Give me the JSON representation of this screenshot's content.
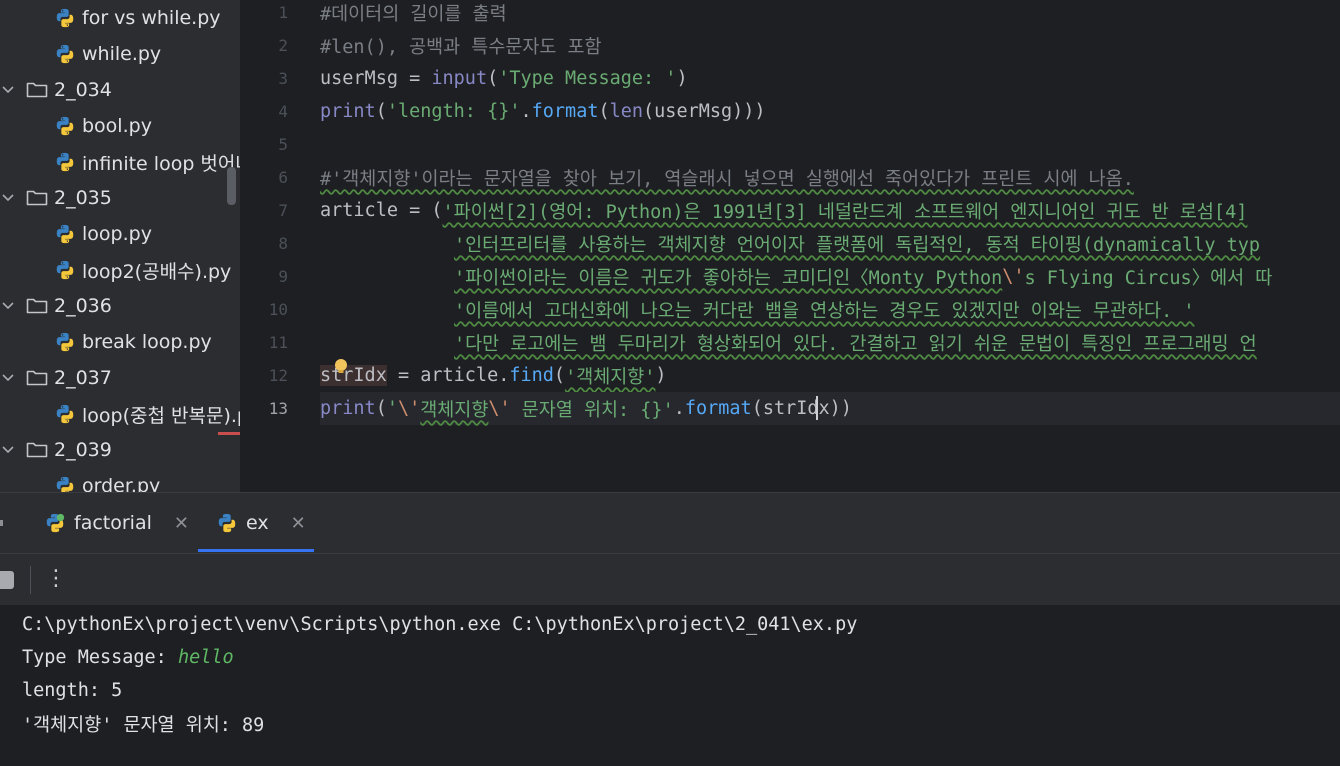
{
  "project_tree": {
    "items": [
      {
        "kind": "file",
        "label": "for vs while.py"
      },
      {
        "kind": "file",
        "label": "while.py"
      },
      {
        "kind": "folder",
        "label": "2_034"
      },
      {
        "kind": "file",
        "label": "bool.py"
      },
      {
        "kind": "file",
        "label": "infinite loop 벗어나"
      },
      {
        "kind": "folder",
        "label": "2_035"
      },
      {
        "kind": "file",
        "label": "loop.py"
      },
      {
        "kind": "file",
        "label": "loop2(공배수).py"
      },
      {
        "kind": "folder",
        "label": "2_036"
      },
      {
        "kind": "file",
        "label": "break loop.py"
      },
      {
        "kind": "folder",
        "label": "2_037"
      },
      {
        "kind": "file",
        "label": "loop(중첩 반복문).py"
      },
      {
        "kind": "folder",
        "label": "2_039"
      },
      {
        "kind": "file",
        "label": "order.py"
      }
    ]
  },
  "editor": {
    "line_numbers": [
      "1",
      "2",
      "3",
      "4",
      "5",
      "6",
      "7",
      "8",
      "9",
      "10",
      "11",
      "12",
      "13"
    ],
    "current_line": "13",
    "lines": {
      "l1": "#데이터의 길이를 출력",
      "l2": "#len(), 공백과 특수문자도 포함",
      "l3": {
        "a": "userMsg = ",
        "b": "input",
        "c": "(",
        "d": "'Type Message: '",
        "e": ")"
      },
      "l4": {
        "a": "print",
        "b": "(",
        "c": "'length: {}'",
        "d": ".",
        "e": "format",
        "f": "(",
        "g": "len",
        "h": "(userMsg)))"
      },
      "l6": "#'객체지향'이라는 문자열을 찾아 보기, 역슬래시 넣으면 실행에선 죽어있다가 프린트 시에 나옴.",
      "l7": {
        "a": "article = (",
        "b": "'파이썬[2](영어: Python)은 1991년[3] 네덜란드계 소프트웨어 엔지니어인 귀도 반 로섬[4]"
      },
      "l8": "'인터프리터를 사용하는 객체지향 언어이자 플랫폼에 독립적인, 동적 타이핑(dynamically typ",
      "l9": {
        "a": "'파이썬이라는 이름은 귀도가 좋아하는 코미디인〈Monty Python",
        "b": "\\'",
        "c": "s Flying Circus〉에서 따"
      },
      "l10": "'이름에서 고대신화에 나오는 커다란 뱀을 연상하는 경우도 있겠지만 이와는 무관하다. '",
      "l11": "'다만 로고에는 뱀 두마리가 형상화되어 있다. 간결하고 읽기 쉬운 문법이 특징인 프로그래밍 언",
      "l12": {
        "a": "strIdx",
        "b": " = article.",
        "c": "find",
        "d": "(",
        "e": "'객체지향'",
        "f": ")"
      },
      "l13": {
        "a": "print",
        "b": "(",
        "c": "'",
        "d": "\\'",
        "e": "객체지향",
        "f": "\\'",
        "g": " 문자열 위치: {}'",
        "h": ".",
        "i": "format",
        "j": "(strIdx))"
      }
    }
  },
  "run_window": {
    "tabs": [
      {
        "label": "factorial",
        "close": "✕"
      },
      {
        "label": "ex",
        "close": "✕"
      }
    ],
    "active_tab": "ex",
    "more_label": "⋮",
    "output": {
      "cmd": "C:\\pythonEx\\project\\venv\\Scripts\\python.exe C:\\pythonEx\\project\\2_041\\ex.py",
      "prompt": "Type Message: ",
      "user_input": "hello",
      "length_line": "length: 5",
      "result_line": "'객체지향' 문자열 위치: 89"
    }
  },
  "colors": {
    "comment": "#7a7e85",
    "string": "#6aab73",
    "function": "#56a8f5",
    "builtin": "#8888c6",
    "escape": "#cf8e6d",
    "accent": "#3574f0"
  }
}
